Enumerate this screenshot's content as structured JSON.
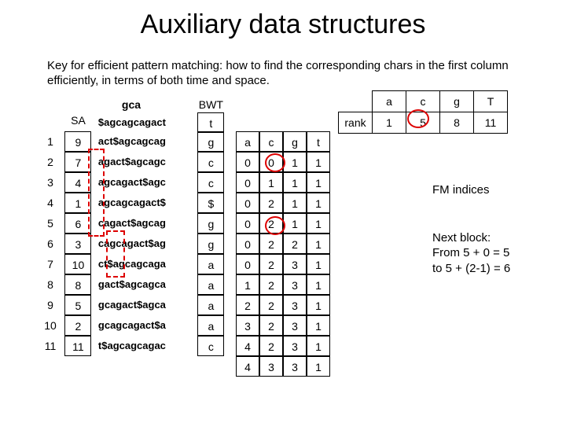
{
  "title": "Auxiliary data structures",
  "subtitle": "Key for efficient pattern matching: how to find the corresponding chars in the first column efficiently, in terms of both time and space.",
  "headers": {
    "sa": "SA",
    "bwt": "BWT",
    "gca": "gca",
    "dollarstr": "$agcagcagact"
  },
  "idx": [
    "1",
    "2",
    "3",
    "4",
    "5",
    "6",
    "7",
    "8",
    "9",
    "10",
    "11"
  ],
  "sa": [
    "9",
    "7",
    "4",
    "1",
    "6",
    "3",
    "10",
    "8",
    "5",
    "2",
    "11"
  ],
  "str": [
    "act$agcagcag",
    "agact$agcagc",
    "agcagact$agc",
    "agcagcagact$",
    "cagact$agcag",
    "cagcagact$ag",
    "ct$agcagcaga",
    "gact$agcagca",
    "gcagact$agca",
    "gcagcagact$a",
    "t$agcagcagac"
  ],
  "bwt": [
    "t",
    "g",
    "c",
    "c",
    "$",
    "g",
    "g",
    "a",
    "a",
    "a",
    "a",
    "c"
  ],
  "fm": {
    "hdr": [
      "a",
      "c",
      "g",
      "t"
    ],
    "rows": [
      [
        "0",
        "0",
        "1",
        "1"
      ],
      [
        "0",
        "1",
        "1",
        "1"
      ],
      [
        "0",
        "2",
        "1",
        "1"
      ],
      [
        "0",
        "2",
        "1",
        "1"
      ],
      [
        "0",
        "2",
        "2",
        "1"
      ],
      [
        "0",
        "2",
        "3",
        "1"
      ],
      [
        "1",
        "2",
        "3",
        "1"
      ],
      [
        "2",
        "2",
        "3",
        "1"
      ],
      [
        "3",
        "2",
        "3",
        "1"
      ],
      [
        "4",
        "2",
        "3",
        "1"
      ],
      [
        "4",
        "3",
        "3",
        "1"
      ]
    ]
  },
  "rank": {
    "label": "rank",
    "hdr": [
      "a",
      "c",
      "g",
      "T"
    ],
    "vals": [
      "1",
      "5",
      "8",
      "11"
    ]
  },
  "labels": {
    "fm": "FM indices",
    "next1": "Next block:",
    "next2": "From 5 + 0 = 5",
    "next3": "to 5 + (2-1) = 6"
  }
}
